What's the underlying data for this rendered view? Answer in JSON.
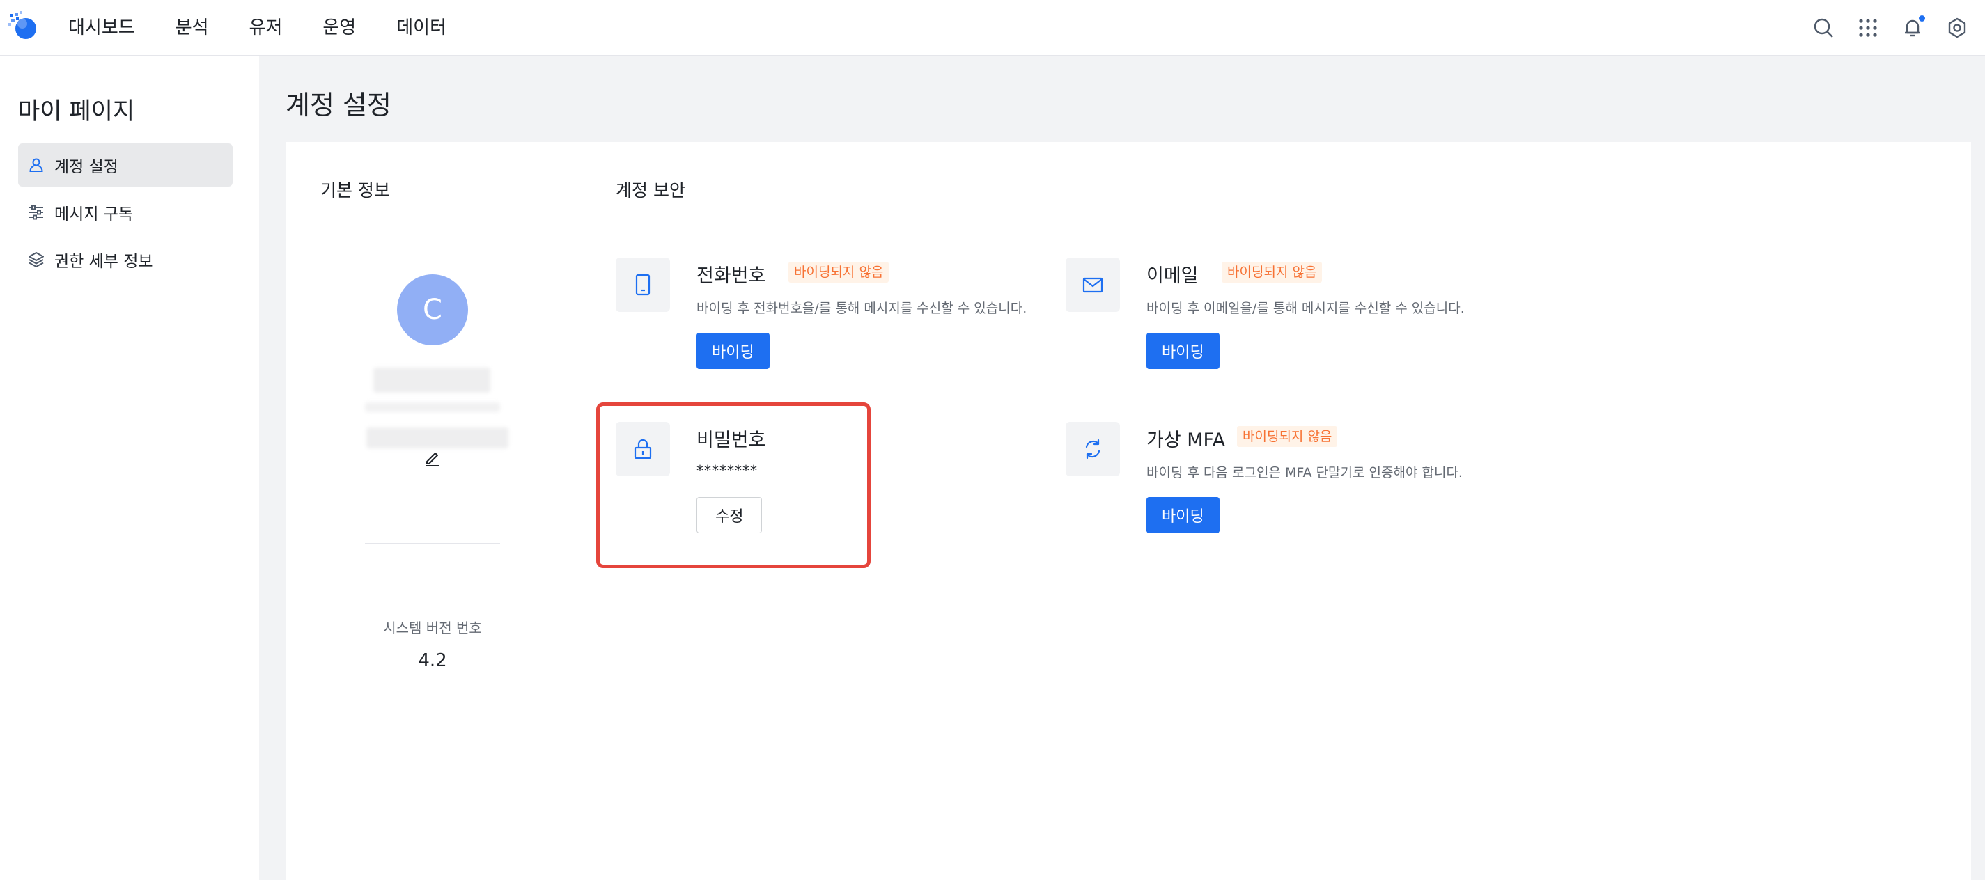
{
  "topnav": {
    "menu": [
      "대시보드",
      "분석",
      "유저",
      "운영",
      "데이터"
    ],
    "actions": [
      {
        "name": "search-icon"
      },
      {
        "name": "apps-grid-icon"
      },
      {
        "name": "bell-icon",
        "has_dot": true
      },
      {
        "name": "gear-icon"
      }
    ]
  },
  "sidebar": {
    "title": "마이 페이지",
    "items": [
      {
        "label": "계정 설정",
        "icon": "user-icon",
        "active": true
      },
      {
        "label": "메시지 구독",
        "icon": "sliders-icon",
        "active": false
      },
      {
        "label": "권한 세부 정보",
        "icon": "layers-icon",
        "active": false
      }
    ]
  },
  "page": {
    "title": "계정 설정"
  },
  "basic_info": {
    "title": "기본 정보",
    "avatar_letter": "C",
    "version_label": "시스템 버전 번호",
    "version_value": "4.2"
  },
  "security": {
    "title": "계정 보안",
    "phone": {
      "name": "전화번호",
      "tag": "바이딩되지 않음",
      "desc": "바이딩 후 전화번호을/를 통해 메시지를 수신할 수 있습니다.",
      "button": "바이딩",
      "icon": "phone-icon"
    },
    "email": {
      "name": "이메일",
      "tag": "바이딩되지 않음",
      "desc": "바이딩 후 이메일을/를 통해 메시지를 수신할 수 있습니다.",
      "button": "바이딩",
      "icon": "mail-icon"
    },
    "password": {
      "name": "비밀번호",
      "mask": "********",
      "button": "수정",
      "icon": "lock-icon"
    },
    "mfa": {
      "name": "가상 MFA",
      "tag": "바이딩되지 않음",
      "desc": "바이딩 후 다음 로그인은 MFA 단말기로 인증해야 합니다.",
      "button": "바이딩",
      "icon": "sync-icon"
    }
  },
  "colors": {
    "primary": "#1e6ff1",
    "tag_bg": "#fff3e8",
    "tag_text": "#f77234",
    "highlight": "#e5453c",
    "avatar": "#91aff5"
  }
}
